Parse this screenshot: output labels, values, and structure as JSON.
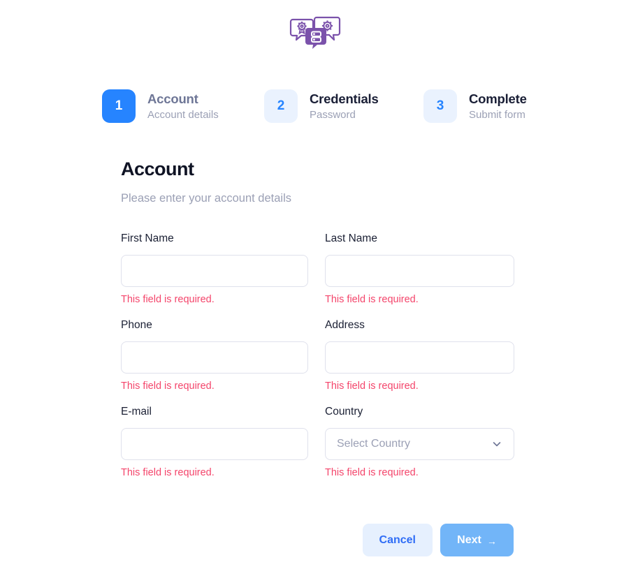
{
  "brand": {
    "logo_icon": "chat-bubbles-gear-server-icon",
    "logo_color": "#7b52ab"
  },
  "colors": {
    "primary": "#2684ff",
    "primary_soft": "#eaf2fe",
    "error": "#f4456b",
    "muted_text": "#9ba0b5",
    "dark_text": "#1a1f36",
    "border": "#dfe1ec",
    "next_button": "#72b5f8",
    "cancel_button_bg": "#e6f0fe",
    "cancel_button_text": "#2f6df6"
  },
  "stepper": {
    "steps": [
      {
        "number": "1",
        "title": "Account",
        "subtitle": "Account details",
        "state": "active"
      },
      {
        "number": "2",
        "title": "Credentials",
        "subtitle": "Password",
        "state": "inactive"
      },
      {
        "number": "3",
        "title": "Complete",
        "subtitle": "Submit form",
        "state": "inactive"
      }
    ]
  },
  "panel": {
    "title": "Account",
    "subtitle": "Please enter your account details"
  },
  "form": {
    "error_message": "This field is required.",
    "fields": [
      {
        "name": "first-name",
        "label": "First Name",
        "value": "",
        "placeholder": "",
        "type": "text",
        "error": "This field is required."
      },
      {
        "name": "last-name",
        "label": "Last Name",
        "value": "",
        "placeholder": "",
        "type": "text",
        "error": "This field is required."
      },
      {
        "name": "phone",
        "label": "Phone",
        "value": "",
        "placeholder": "",
        "type": "text",
        "error": "This field is required."
      },
      {
        "name": "address",
        "label": "Address",
        "value": "",
        "placeholder": "",
        "type": "text",
        "error": "This field is required."
      },
      {
        "name": "email",
        "label": "E-mail",
        "value": "",
        "placeholder": "",
        "type": "text",
        "error": "This field is required."
      },
      {
        "name": "country",
        "label": "Country",
        "value": "Select Country",
        "placeholder": "Select Country",
        "type": "select",
        "error": "This field is required."
      }
    ]
  },
  "actions": {
    "cancel_label": "Cancel",
    "next_label": "Next",
    "next_arrow": "→"
  }
}
